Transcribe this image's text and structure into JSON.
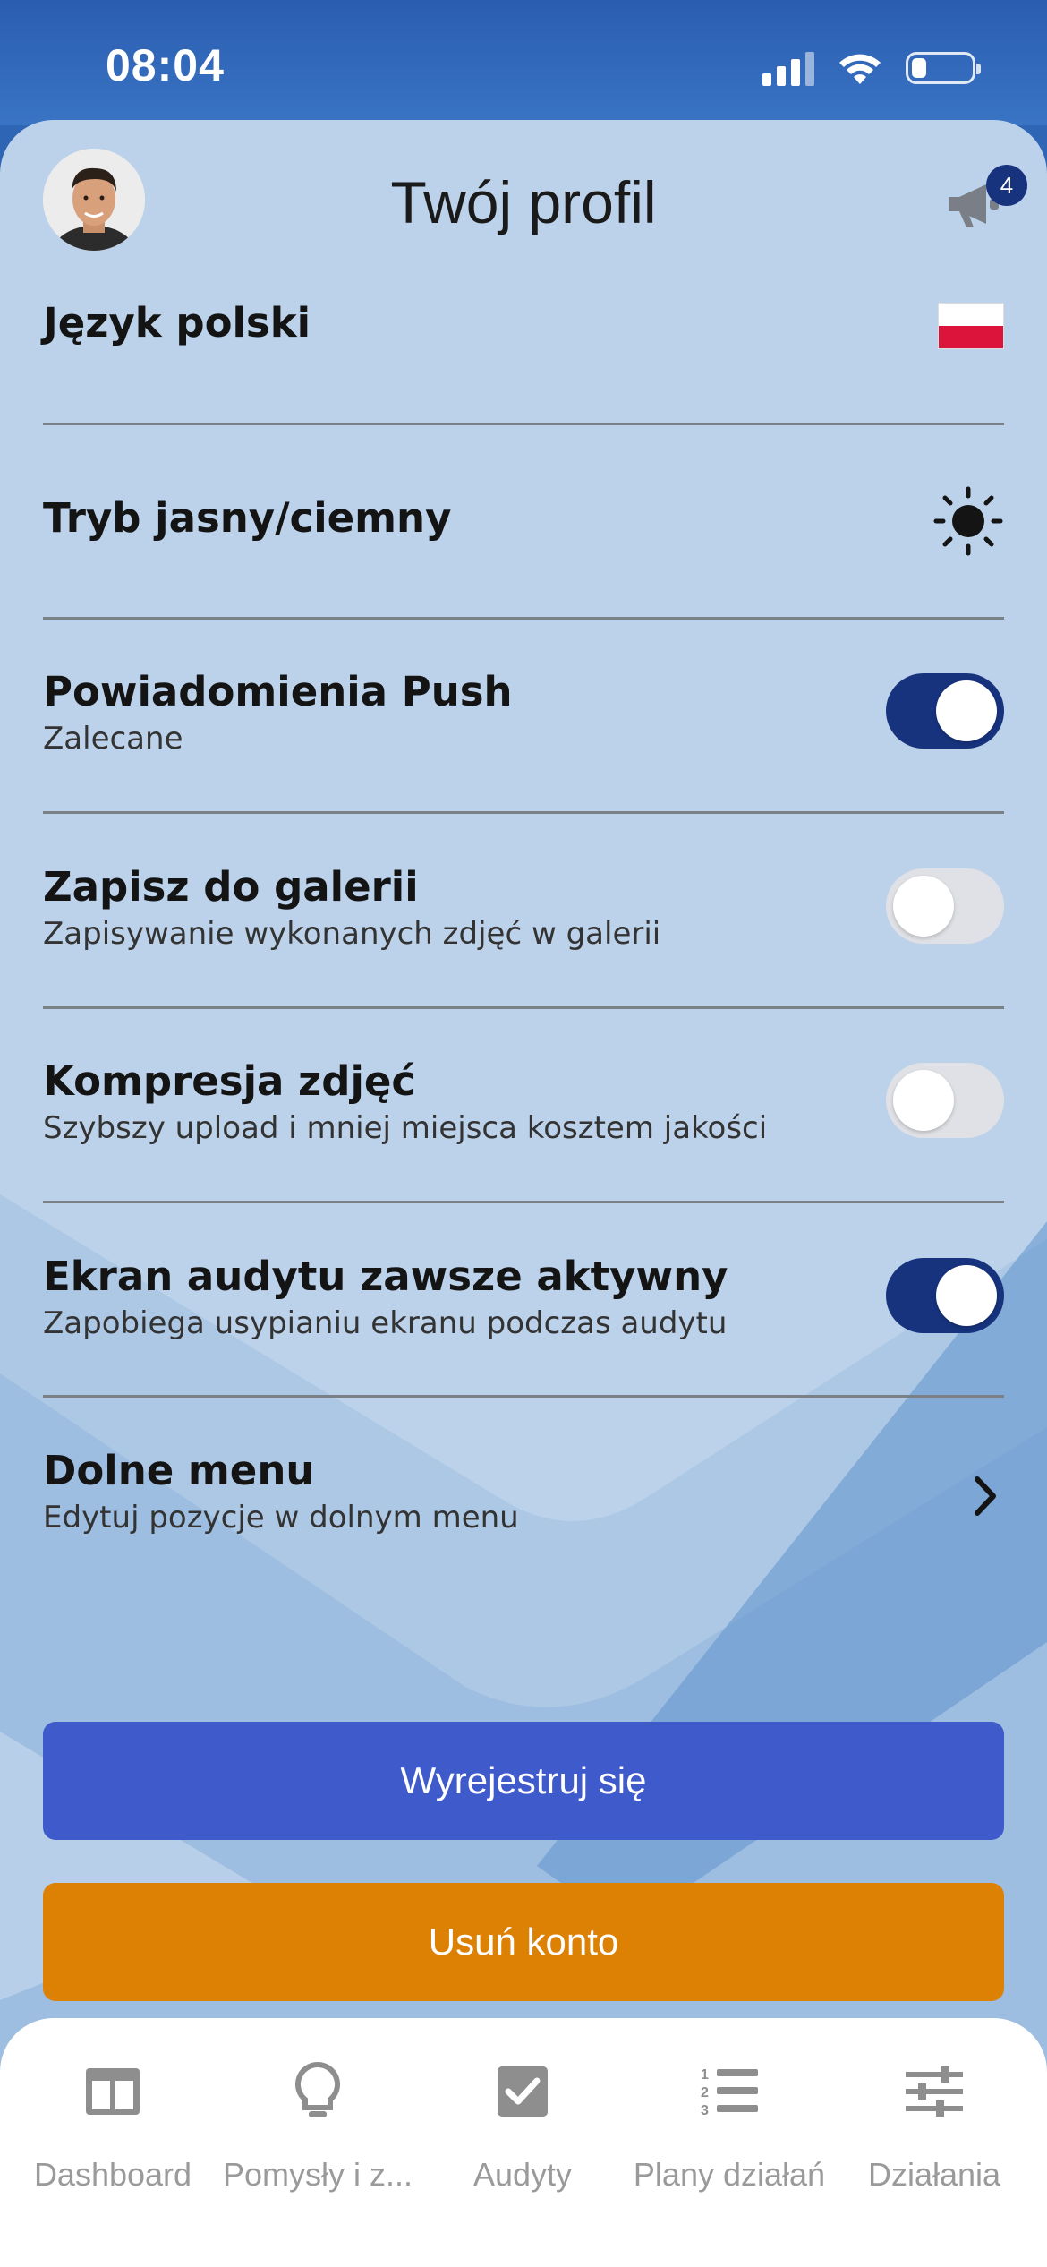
{
  "status_bar": {
    "time": "08:04"
  },
  "header": {
    "title": "Twój profil",
    "notifications_count": "4"
  },
  "settings": {
    "language": {
      "title": "Język polski"
    },
    "theme": {
      "title": "Tryb jasny/ciemny"
    },
    "push": {
      "title": "Powiadomienia Push",
      "subtitle": "Zalecane",
      "enabled": true
    },
    "gallery": {
      "title": "Zapisz do galerii",
      "subtitle": "Zapisywanie wykonanych zdjęć w galerii",
      "enabled": false
    },
    "compression": {
      "title": "Kompresja zdjęć",
      "subtitle": "Szybszy upload i mniej miejsca kosztem jakości",
      "enabled": false
    },
    "screen_on": {
      "title": "Ekran audytu zawsze aktywny",
      "subtitle": "Zapobiega usypianiu ekranu podczas audytu",
      "enabled": true
    },
    "bottom_menu": {
      "title": "Dolne menu",
      "subtitle": "Edytuj pozycje w dolnym menu"
    }
  },
  "buttons": {
    "logout": "Wyrejestruj się",
    "delete_account": "Usuń konto"
  },
  "tabbar": {
    "items": [
      {
        "label": "Dashboard",
        "icon": "dashboard-icon"
      },
      {
        "label": "Pomysły i z...",
        "icon": "lightbulb-icon"
      },
      {
        "label": "Audyty",
        "icon": "checkbox-icon"
      },
      {
        "label": "Plany działań",
        "icon": "numbered-list-icon"
      },
      {
        "label": "Działania",
        "icon": "sliders-icon"
      }
    ]
  },
  "colors": {
    "accent": "#17337e",
    "logout": "#3f5bcb",
    "delete": "#dc8104",
    "background": "#bcd2ea"
  }
}
